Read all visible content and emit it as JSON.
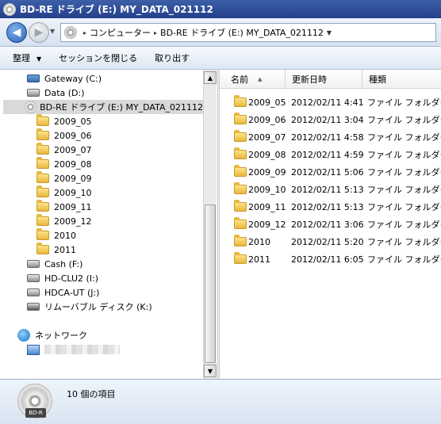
{
  "window": {
    "title": "BD-RE ドライブ (E:) MY_DATA_021112"
  },
  "address": {
    "segments": [
      "コンピューター",
      "BD-RE ドライブ (E:) MY_DATA_021112"
    ]
  },
  "toolbar": {
    "organize": "整理",
    "close_session": "セッションを閉じる",
    "eject": "取り出す"
  },
  "nav": {
    "drives": [
      {
        "label": "Gateway (C:)",
        "icon": "windows-drive-icon"
      },
      {
        "label": "Data (D:)",
        "icon": "hard-drive-icon"
      },
      {
        "label": "BD-RE ドライブ (E:) MY_DATA_021112",
        "icon": "disc-icon",
        "selected": true
      }
    ],
    "folders": [
      "2009_05",
      "2009_06",
      "2009_07",
      "2009_08",
      "2009_09",
      "2009_10",
      "2009_11",
      "2009_12",
      "2010",
      "2011"
    ],
    "other_drives": [
      {
        "label": "Cash (F:)"
      },
      {
        "label": "HD-CLU2 (I:)"
      },
      {
        "label": "HDCA-UT (J:)"
      },
      {
        "label": "リムーバブル ディスク (K:)"
      }
    ],
    "network": "ネットワーク"
  },
  "columns": {
    "name": "名前",
    "modified": "更新日時",
    "type": "種類"
  },
  "files": [
    {
      "name": "2009_05",
      "date": "2012/02/11 4:41",
      "type": "ファイル フォルダー"
    },
    {
      "name": "2009_06",
      "date": "2012/02/11 3:04",
      "type": "ファイル フォルダー"
    },
    {
      "name": "2009_07",
      "date": "2012/02/11 4:58",
      "type": "ファイル フォルダー"
    },
    {
      "name": "2009_08",
      "date": "2012/02/11 4:59",
      "type": "ファイル フォルダー"
    },
    {
      "name": "2009_09",
      "date": "2012/02/11 5:06",
      "type": "ファイル フォルダー"
    },
    {
      "name": "2009_10",
      "date": "2012/02/11 5:13",
      "type": "ファイル フォルダー"
    },
    {
      "name": "2009_11",
      "date": "2012/02/11 5:13",
      "type": "ファイル フォルダー"
    },
    {
      "name": "2009_12",
      "date": "2012/02/11 3:06",
      "type": "ファイル フォルダー"
    },
    {
      "name": "2010",
      "date": "2012/02/11 5:20",
      "type": "ファイル フォルダー"
    },
    {
      "name": "2011",
      "date": "2012/02/11 6:05",
      "type": "ファイル フォルダー"
    }
  ],
  "status": {
    "item_count": "10 個の項目",
    "drive_badge": "BD-R"
  }
}
